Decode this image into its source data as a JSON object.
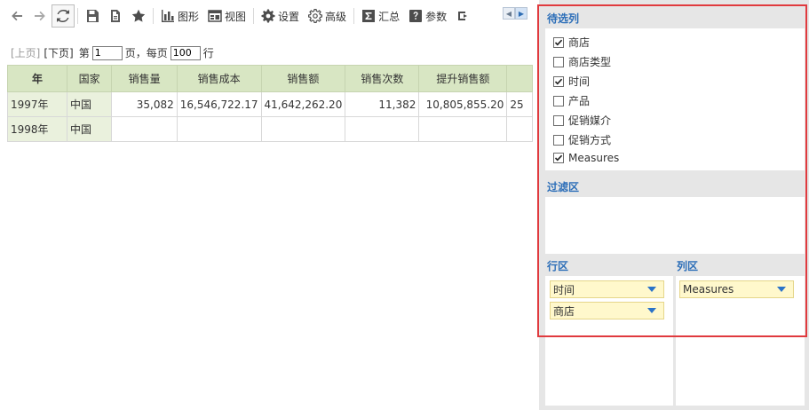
{
  "toolbar": {
    "items": [
      {
        "icon": "back-arrow-icon",
        "label": ""
      },
      {
        "icon": "forward-arrow-icon",
        "label": ""
      },
      {
        "icon": "refresh-icon",
        "label": ""
      },
      {
        "icon": "save-icon",
        "label": ""
      },
      {
        "icon": "save-as-icon",
        "label": ""
      },
      {
        "icon": "star-icon",
        "label": ""
      },
      {
        "icon": "bar-chart-icon",
        "label": "图形"
      },
      {
        "icon": "view-icon",
        "label": "视图"
      },
      {
        "icon": "gear-icon",
        "label": "设置"
      },
      {
        "icon": "advanced-gear-icon",
        "label": "高级"
      },
      {
        "icon": "sum-icon",
        "label": "汇总"
      },
      {
        "icon": "help-icon",
        "label": "参数"
      }
    ]
  },
  "pager": {
    "prev": "[上页]",
    "next": "[下页]",
    "page_prefix": "第",
    "page_value": "1",
    "page_suffix": "页，每页",
    "page_size": "100",
    "rows_suffix": "行"
  },
  "grid": {
    "columns": [
      "年",
      "国家",
      "销售量",
      "销售成本",
      "销售额",
      "销售次数",
      "提升销售额"
    ],
    "rows": [
      [
        "1997年",
        "中国",
        "35,082",
        "16,546,722.17",
        "41,642,262.20",
        "11,382",
        "10,805,855.20",
        "25"
      ],
      [
        "1998年",
        "中国",
        "",
        "",
        "",
        "",
        "",
        ""
      ]
    ]
  },
  "panel": {
    "candidates_title": "待选列",
    "candidates": [
      {
        "label": "商店",
        "checked": true
      },
      {
        "label": "商店类型",
        "checked": false
      },
      {
        "label": "时间",
        "checked": true
      },
      {
        "label": "产品",
        "checked": false
      },
      {
        "label": "促销媒介",
        "checked": false
      },
      {
        "label": "促销方式",
        "checked": false
      },
      {
        "label": "Measures",
        "checked": true
      }
    ],
    "filter_title": "过滤区",
    "row_title": "行区",
    "col_title": "列区",
    "row_chips": [
      "时间",
      "商店"
    ],
    "col_chips": [
      "Measures"
    ]
  },
  "colors": {
    "header_bg": "#d8e6c3",
    "row_header_bg": "#eaf1dd",
    "panel_frame": "#e03a3e",
    "section_title": "#2c6eb8",
    "chip_bg": "#fff8cc",
    "dropdown_arrow": "#2a73c8"
  }
}
